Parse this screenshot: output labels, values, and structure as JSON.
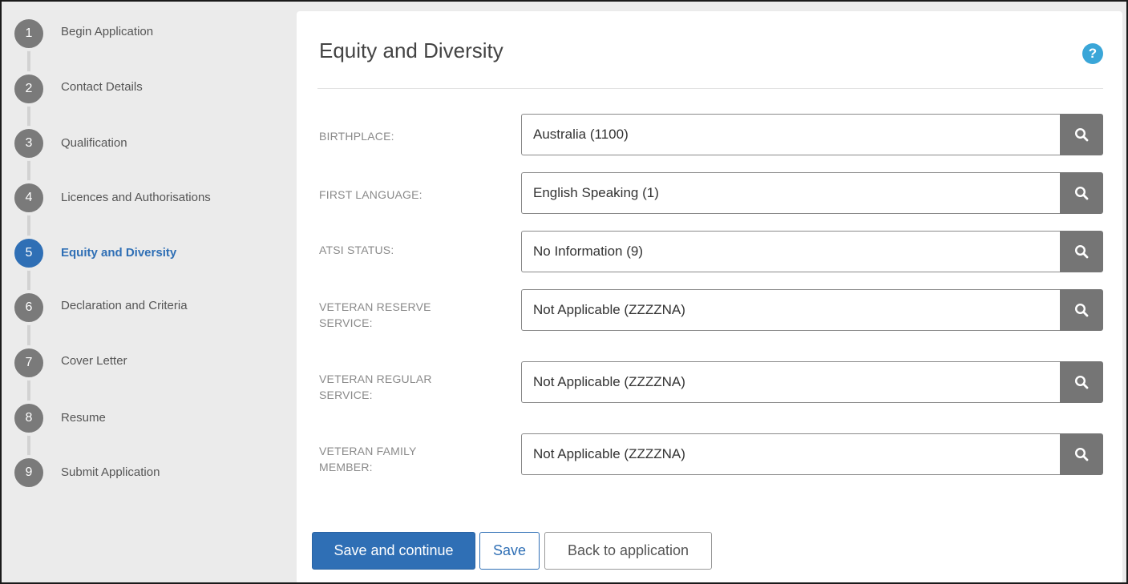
{
  "sidebar": {
    "steps": [
      {
        "num": "1",
        "label": "Begin Application"
      },
      {
        "num": "2",
        "label": "Contact Details"
      },
      {
        "num": "3",
        "label": "Qualification"
      },
      {
        "num": "4",
        "label": "Licences and Authorisations"
      },
      {
        "num": "5",
        "label": "Equity and Diversity",
        "active": true
      },
      {
        "num": "6",
        "label": "Declaration and Criteria"
      },
      {
        "num": "7",
        "label": "Cover Letter"
      },
      {
        "num": "8",
        "label": "Resume"
      },
      {
        "num": "9",
        "label": "Submit Application"
      }
    ]
  },
  "panel": {
    "title": "Equity and Diversity",
    "help_icon": "question-circle-icon",
    "fields": [
      {
        "label": "BIRTHPLACE:",
        "value": "Australia (1100)"
      },
      {
        "label": "FIRST LANGUAGE:",
        "value": "English Speaking (1)"
      },
      {
        "label": "ATSI STATUS:",
        "value": "No Information (9)"
      },
      {
        "label": "VETERAN RESERVE SERVICE:",
        "value": "Not Applicable (ZZZZNA)"
      },
      {
        "label": "VETERAN REGULAR SERVICE:",
        "value": "Not Applicable (ZZZZNA)"
      },
      {
        "label": "VETERAN FAMILY MEMBER:",
        "value": "Not Applicable (ZZZZNA)"
      }
    ]
  },
  "buttons": {
    "save_continue": "Save and continue",
    "save": "Save",
    "back": "Back to application"
  },
  "colors": {
    "accent": "#2f6fb5",
    "help": "#3aa6d8",
    "step_inactive": "#7a7a7a",
    "search_button": "#757575"
  }
}
